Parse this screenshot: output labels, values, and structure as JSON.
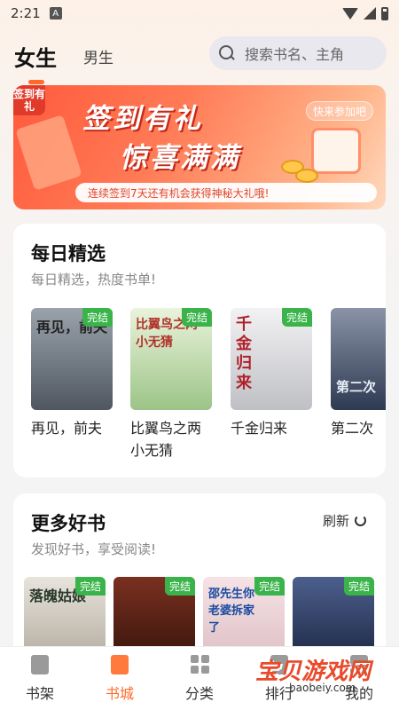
{
  "status_bar": {
    "time": "2:21",
    "app_icon": "A"
  },
  "header": {
    "tabs": [
      {
        "label": "女生",
        "active": true
      },
      {
        "label": "男生",
        "active": false
      }
    ],
    "search_placeholder": "搜索书名、主角"
  },
  "banner": {
    "tag": "签到有礼",
    "title_line1": "签到有礼",
    "title_line2": "惊喜满满",
    "cta": "快来参加吧",
    "strip_text": "连续签到7天还有机会获得神秘大礼哦!"
  },
  "daily": {
    "title": "每日精选",
    "subtitle": "每日精选，热度书单!",
    "books": [
      {
        "title": "再见，前夫",
        "cover_text": "再见，前夫",
        "badge": "完结",
        "cover_color": "#6e7680"
      },
      {
        "title": "比翼鸟之两小无猜",
        "cover_text": "比翼鸟之两小无猜",
        "badge": "完结",
        "cover_color": "#b9d6a2"
      },
      {
        "title": "千金归来",
        "cover_text": "千金归来",
        "badge": "完结",
        "cover_color": "#d9d9dc"
      },
      {
        "title": "第二次",
        "cover_text": "第二次",
        "badge": "",
        "cover_color": "#4e5a70"
      }
    ]
  },
  "more": {
    "title": "更多好书",
    "subtitle": "发现好书，享受阅读!",
    "refresh_label": "刷新",
    "books": [
      {
        "cover_text": "落魄姑娘",
        "badge": "完结",
        "cover_color": "#c7c0b3"
      },
      {
        "cover_text": "",
        "badge": "完结",
        "cover_color": "#5a2418"
      },
      {
        "cover_text": "邵先生你老婆拆家了",
        "badge": "完结",
        "cover_color": "#e9cfd2"
      },
      {
        "cover_text": "",
        "badge": "完结",
        "cover_color": "#243358"
      }
    ]
  },
  "nav": {
    "items": [
      {
        "label": "书架",
        "active": false
      },
      {
        "label": "书城",
        "active": true
      },
      {
        "label": "分类",
        "active": false
      },
      {
        "label": "排行",
        "active": false
      },
      {
        "label": "我的",
        "active": false
      }
    ]
  },
  "watermark": {
    "text": "宝贝游戏网",
    "url": "baobeiy.com"
  }
}
